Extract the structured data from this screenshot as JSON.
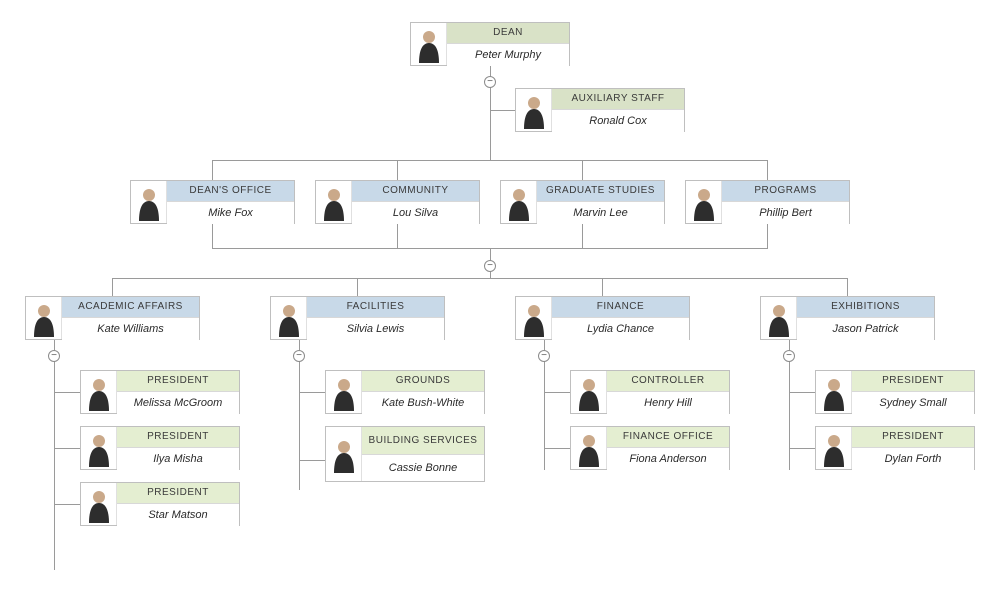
{
  "org": {
    "dean": {
      "title": "DEAN",
      "name": "Peter Murphy"
    },
    "aux": {
      "title": "AUXILIARY STAFF",
      "name": "Ronald Cox"
    },
    "deansoffice": {
      "title": "DEAN'S OFFICE",
      "name": "Mike Fox"
    },
    "community": {
      "title": "COMMUNITY",
      "name": "Lou Silva"
    },
    "grad": {
      "title": "GRADUATE STUDIES",
      "name": "Marvin Lee"
    },
    "programs": {
      "title": "PROGRAMS",
      "name": "Phillip Bert"
    },
    "academic": {
      "title": "ACADEMIC AFFAIRS",
      "name": "Kate Williams"
    },
    "facilities": {
      "title": "FACILITIES",
      "name": "Silvia Lewis"
    },
    "finance": {
      "title": "FINANCE",
      "name": "Lydia Chance"
    },
    "exhibitions": {
      "title": "EXHIBITIONS",
      "name": "Jason Patrick"
    },
    "aa1": {
      "title": "PRESIDENT",
      "name": "Melissa McGroom"
    },
    "aa2": {
      "title": "PRESIDENT",
      "name": "Ilya Misha"
    },
    "aa3": {
      "title": "PRESIDENT",
      "name": "Star Matson"
    },
    "fac1": {
      "title": "GROUNDS",
      "name": "Kate Bush-White"
    },
    "fac2": {
      "title": "BUILDING SERVICES",
      "name": "Cassie Bonne"
    },
    "fin1": {
      "title": "CONTROLLER",
      "name": "Henry Hill"
    },
    "fin2": {
      "title": "FINANCE OFFICE",
      "name": "Fiona Anderson"
    },
    "ex1": {
      "title": "PRESIDENT",
      "name": "Sydney Small"
    },
    "ex2": {
      "title": "PRESIDENT",
      "name": "Dylan Forth"
    }
  },
  "toggle_glyph": "−",
  "colors": {
    "green_header": "#d9e2c7",
    "blue_header": "#c8d9e8",
    "sage_header": "#e4eed1",
    "border": "#bfbfbf",
    "connector": "#9a9a9a"
  }
}
